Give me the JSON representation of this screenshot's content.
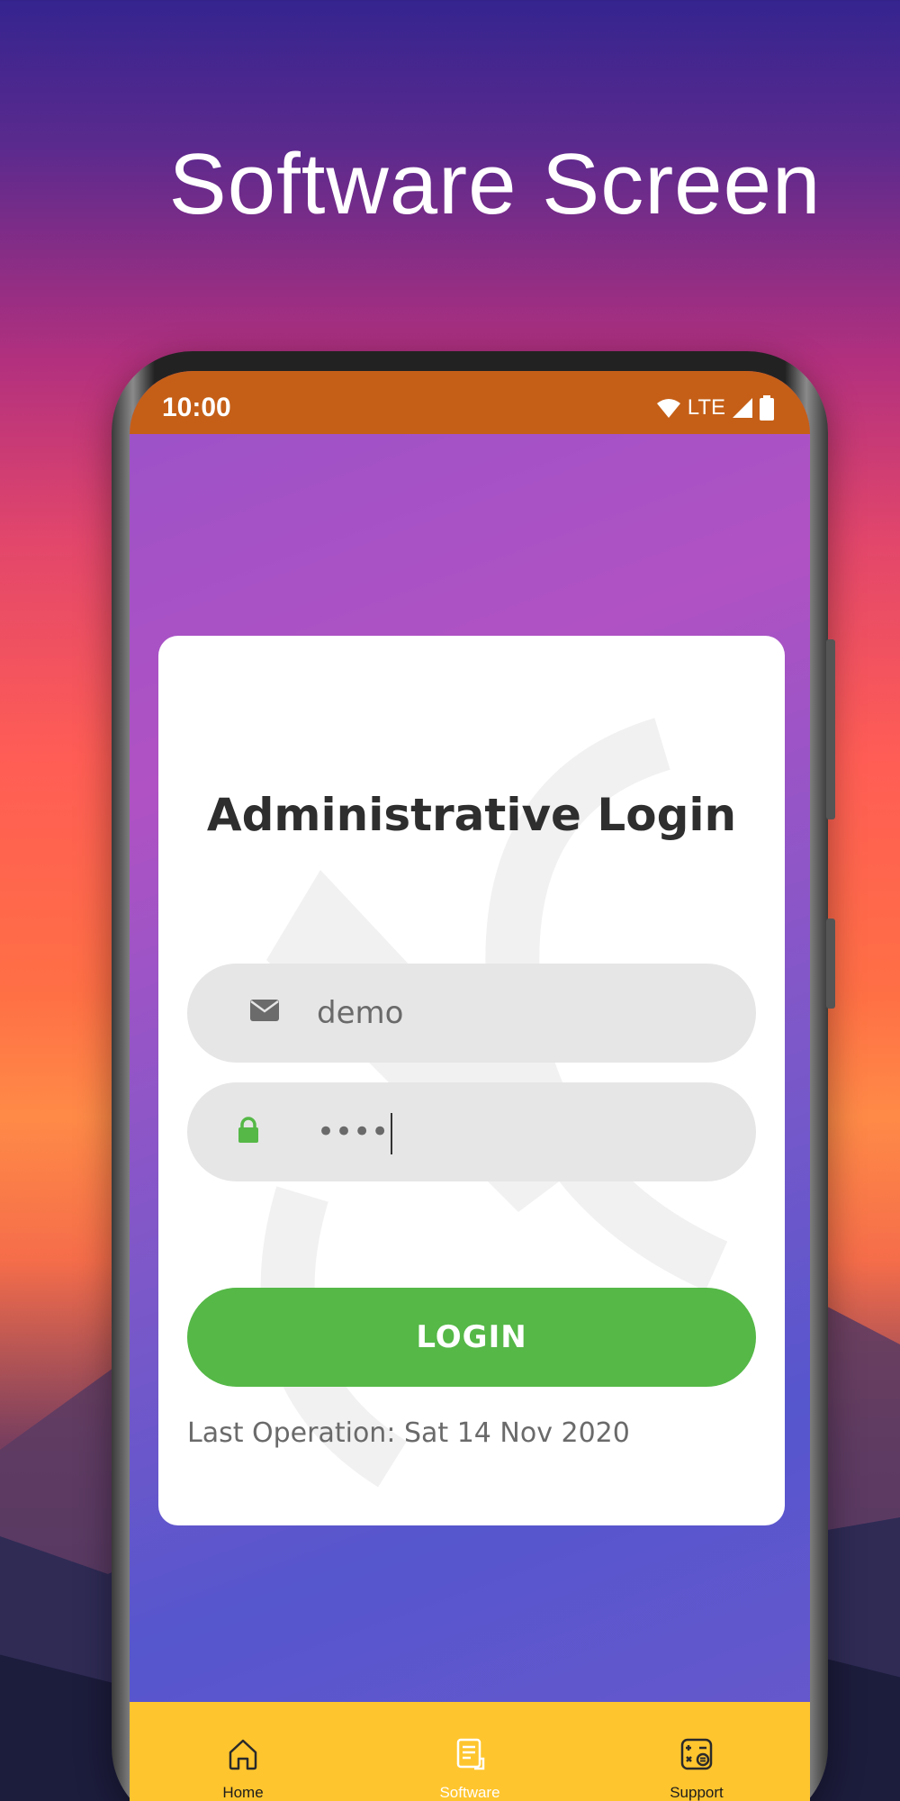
{
  "headline": "Software Screen",
  "statusbar": {
    "time": "10:00",
    "network": "LTE"
  },
  "login_card": {
    "title": "Administrative Login",
    "username": {
      "value": "demo"
    },
    "password": {
      "value": "••••"
    },
    "login_button": "LOGIN",
    "last_operation": "Last Operation: Sat 14 Nov 2020"
  },
  "bottom_nav": {
    "items": [
      {
        "label": "Home",
        "icon": "home-icon"
      },
      {
        "label": "Software",
        "icon": "document-icon",
        "active": true
      },
      {
        "label": "Support",
        "icon": "calculator-icon"
      }
    ]
  },
  "colors": {
    "status_bar": "#c55f17",
    "login_button": "#55b847",
    "bottom_nav": "#fec52e",
    "lock_icon": "#55b847"
  }
}
